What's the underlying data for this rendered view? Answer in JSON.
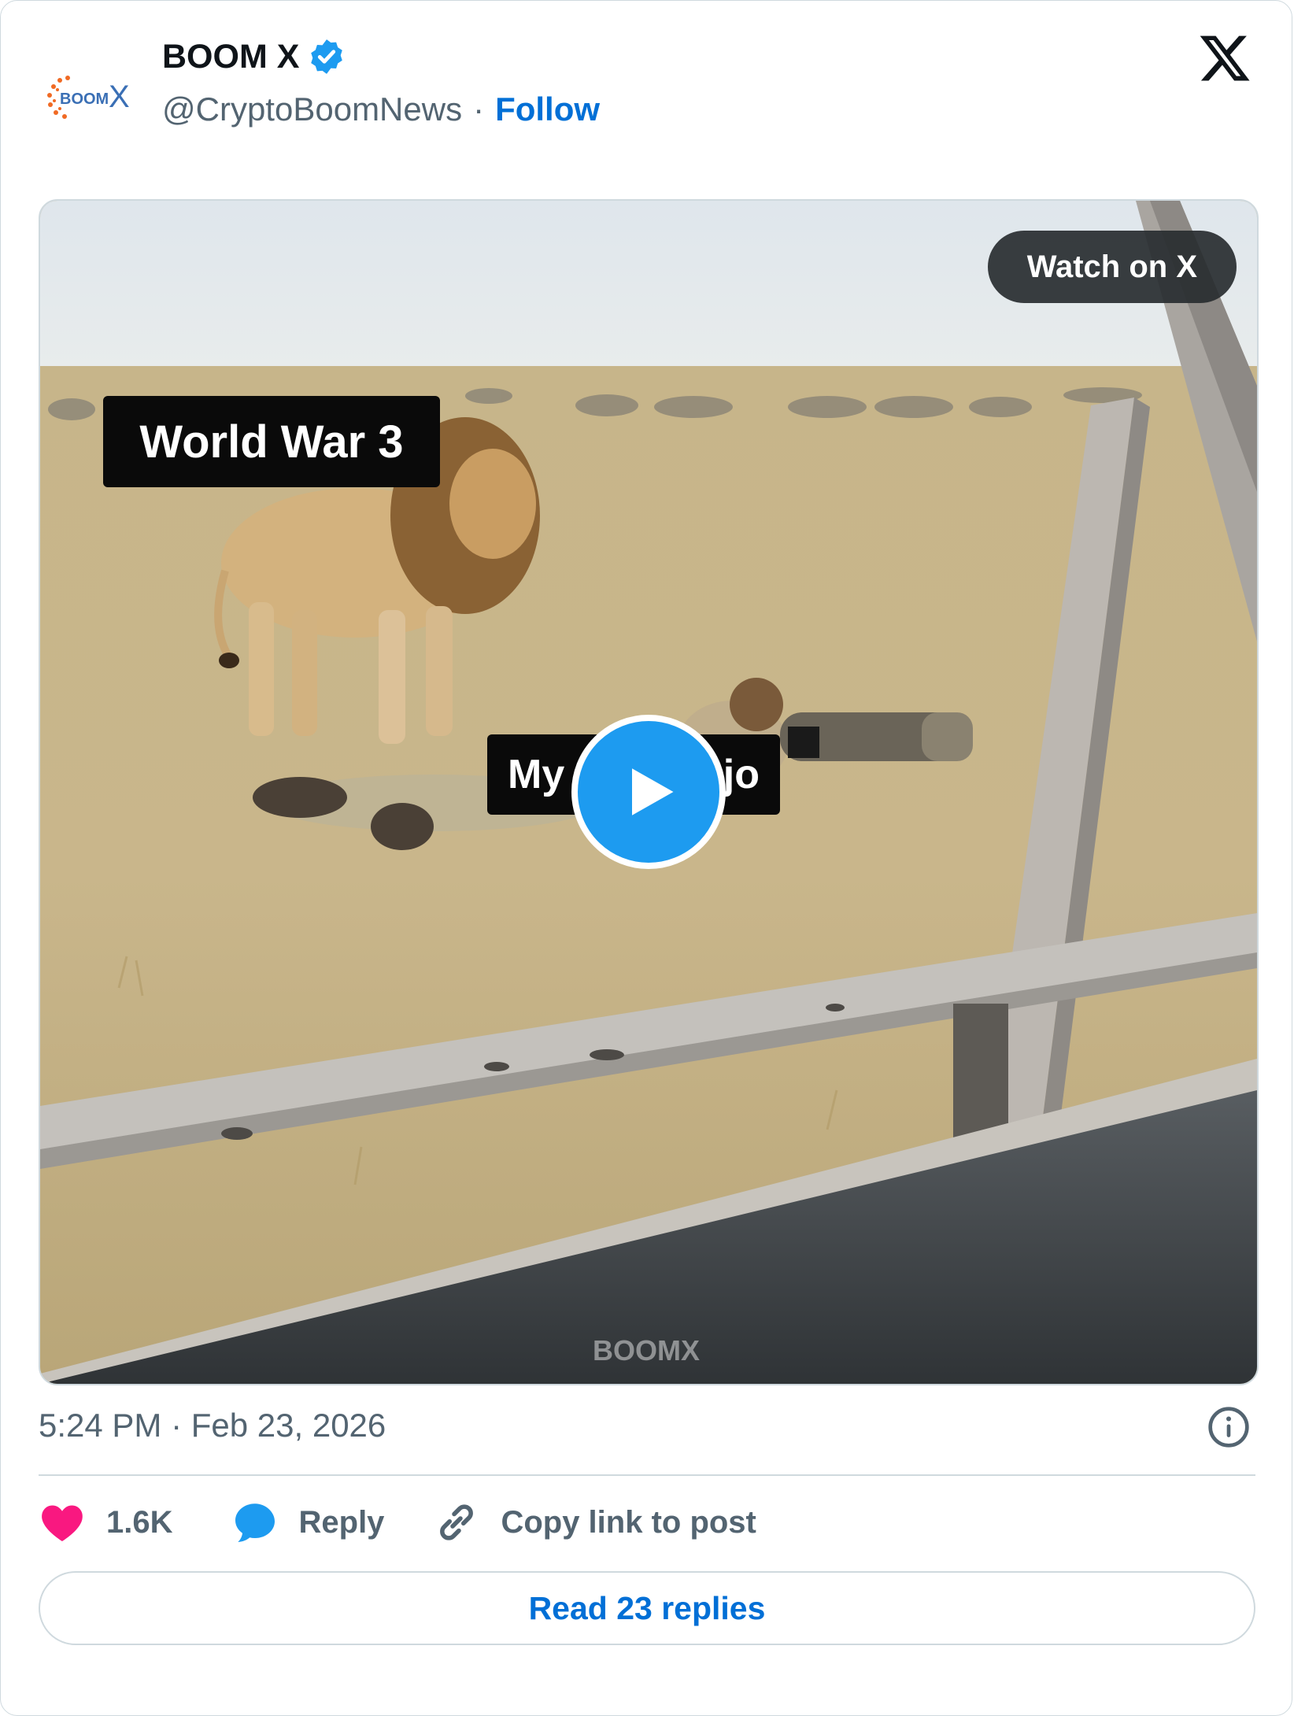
{
  "author": {
    "name": "BOOM X",
    "handle": "@CryptoBoomNews",
    "separator": "·",
    "follow_label": "Follow",
    "avatar_text_boom": "BOOM",
    "avatar_text_x": "X",
    "verified": true
  },
  "media": {
    "watch_label": "Watch on X",
    "caption_top": "World War 3",
    "caption_bottom_left": "My",
    "caption_bottom_right": "jo",
    "watermark": "BOOMX"
  },
  "post": {
    "timestamp": "5:24 PM · Feb 23, 2026"
  },
  "actions": {
    "likes": "1.6K",
    "reply_label": "Reply",
    "copy_label": "Copy link to post"
  },
  "read_replies_label": "Read 23 replies",
  "colors": {
    "link_blue": "#006fd6",
    "play_blue": "#1d9bf0",
    "like_pink": "#f91880",
    "reply_blue": "#1d9bf0",
    "muted": "#536471"
  },
  "icons": [
    "verified-badge-icon",
    "x-logo-icon",
    "play-icon",
    "info-icon",
    "heart-icon",
    "reply-bubble-icon",
    "link-icon"
  ]
}
